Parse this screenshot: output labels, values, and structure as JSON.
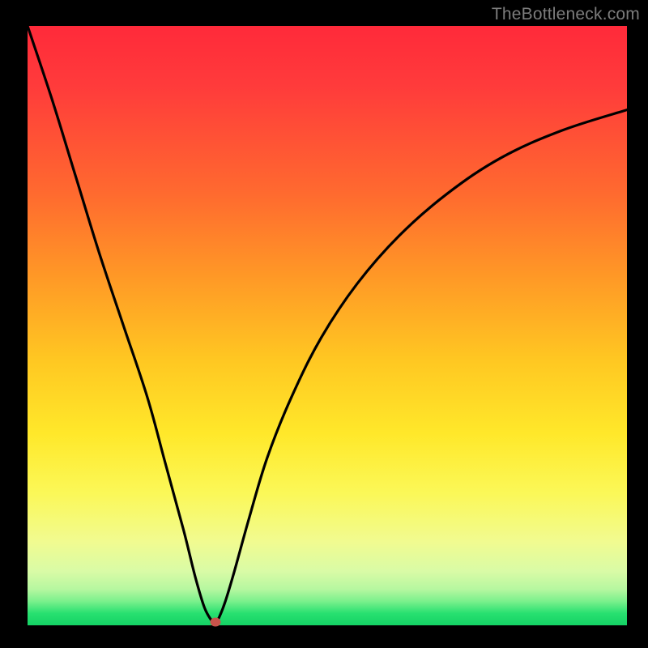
{
  "watermark": "TheBottleneck.com",
  "chart_data": {
    "type": "line",
    "title": "",
    "xlabel": "",
    "ylabel": "",
    "xlim": [
      0,
      100
    ],
    "ylim": [
      0,
      100
    ],
    "grid": false,
    "series": [
      {
        "name": "curve",
        "x": [
          0,
          4,
          8,
          12,
          16,
          20,
          23,
          26,
          28,
          29.5,
          30.7,
          31.0,
          31.5,
          32.0,
          33.0,
          34.5,
          37,
          40,
          44,
          49,
          55,
          62,
          70,
          79,
          89,
          100
        ],
        "y": [
          100,
          88,
          75,
          62,
          50,
          38,
          27,
          16,
          8,
          3,
          0.8,
          0.6,
          0.7,
          1.4,
          4.0,
          9.0,
          18,
          28,
          38,
          48,
          57,
          65,
          72,
          78,
          82.5,
          86
        ]
      }
    ],
    "marker": {
      "x": 31.4,
      "y": 0.5
    },
    "colors": {
      "curve": "#000000",
      "marker": "#c9534b",
      "gradient_top": "#ff2a3a",
      "gradient_bottom": "#14d264"
    }
  }
}
